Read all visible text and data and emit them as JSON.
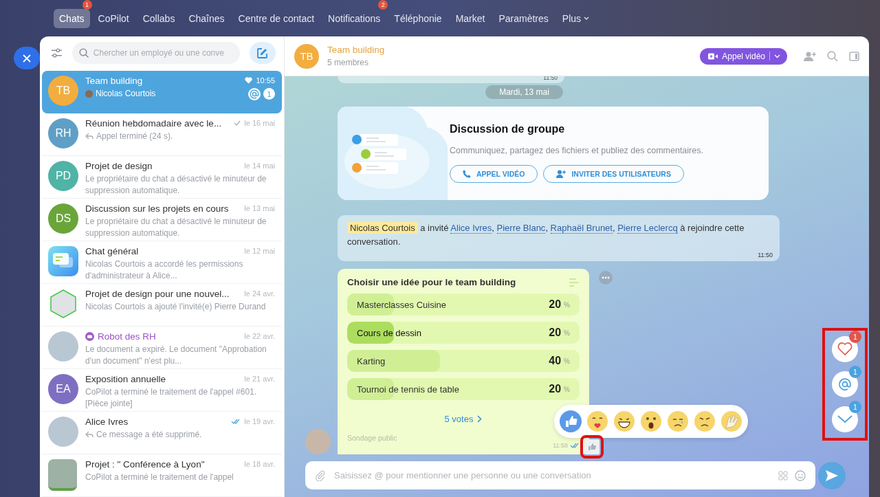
{
  "nav": [
    {
      "label": "Chats",
      "selected": true,
      "badge": "1"
    },
    {
      "label": "CoPilot",
      "selected": false
    },
    {
      "label": "Collabs",
      "selected": false
    },
    {
      "label": "Chaînes",
      "selected": false
    },
    {
      "label": "Centre de contact",
      "selected": false
    },
    {
      "label": "Notifications",
      "selected": false,
      "badge": "2"
    },
    {
      "label": "Téléphonie",
      "selected": false
    },
    {
      "label": "Market",
      "selected": false
    },
    {
      "label": "Paramètres",
      "selected": false
    },
    {
      "label": "Plus",
      "selected": false,
      "dropdown": true
    }
  ],
  "sidebar": {
    "search": {
      "placeholder": "Chercher un employé ou une conve"
    },
    "chats": [
      {
        "avatar": {
          "kind": "initials",
          "initials": "TB",
          "color": "#f2ad3e"
        },
        "name": "Team building",
        "bot": false,
        "time": "10:55",
        "favorite": true,
        "preview_prefix": {
          "kind": "author-avatar"
        },
        "preview": "Nicolas Courtois",
        "mention": true,
        "unread": "1",
        "selected": true
      },
      {
        "avatar": {
          "kind": "initials",
          "initials": "RH",
          "color": "#5f9fc6"
        },
        "name": "Réunion hebdomadaire avec le...",
        "bot": false,
        "time": "le 16 mai",
        "favorite": false,
        "check": {
          "kind": "sent"
        },
        "preview_prefix": {
          "kind": "reply"
        },
        "preview": "Appel terminé (24 s).",
        "mention": false,
        "selected": false
      },
      {
        "avatar": {
          "kind": "initials",
          "initials": "PD",
          "color": "#4fb3a6"
        },
        "name": "Projet de design",
        "bot": false,
        "time": "le 14 mai",
        "favorite": false,
        "preview": "Le propriétaire du chat a désactivé le minuteur de suppression automatique.",
        "mention": false,
        "selected": false
      },
      {
        "avatar": {
          "kind": "initials",
          "initials": "DS",
          "color": "#6aa53a"
        },
        "name": "Discussion sur les projets en cours",
        "bot": false,
        "time": "le 13 mai",
        "favorite": false,
        "preview": "Le propriétaire du chat a désactivé le minuteur de suppression automatique.",
        "mention": false,
        "selected": false
      },
      {
        "avatar": {
          "kind": "app"
        },
        "name": "Chat général",
        "bot": false,
        "time": "le 12 mai",
        "favorite": false,
        "preview": "Nicolas Courtois a accordé les permissions d'administrateur à Alice...",
        "mention": false,
        "selected": false
      },
      {
        "avatar": {
          "kind": "hexagon-photo"
        },
        "name": "Projet de design pour une nouvel...",
        "bot": false,
        "time": "le 24 avr.",
        "favorite": false,
        "preview": "Nicolas Courtois a ajouté l'invité(e) Pierre Durand",
        "mention": false,
        "selected": false
      },
      {
        "avatar": {
          "kind": "photo"
        },
        "name": "Robot des RH",
        "bot": true,
        "time": "le 22 avr.",
        "favorite": false,
        "preview": "Le document a expiré. Le document \"Approbation d'un document\" n'est plu...",
        "mention": false,
        "selected": false
      },
      {
        "avatar": {
          "kind": "initials",
          "initials": "EA",
          "color": "#7f6fc2"
        },
        "name": "Exposition annuelle",
        "bot": false,
        "time": "le 21 avr.",
        "favorite": false,
        "preview": "CoPilot a terminé le traitement de l'appel #601. [Pièce jointe]",
        "mention": false,
        "selected": false
      },
      {
        "avatar": {
          "kind": "photo"
        },
        "name": "Alice Ivres",
        "bot": false,
        "time": "le 19 avr.",
        "favorite": false,
        "check": {
          "kind": "read"
        },
        "preview_prefix": {
          "kind": "reply"
        },
        "preview": "Ce message a été supprimé.",
        "mention": false,
        "selected": false
      },
      {
        "avatar": {
          "kind": "square-photo"
        },
        "name": "Projet : \" Conférence à Lyon\"",
        "bot": false,
        "time": "le 18 avr.",
        "favorite": false,
        "preview": "CoPilot a terminé le traitement de l'appel",
        "mention": false,
        "selected": false
      }
    ]
  },
  "header": {
    "initials": "TB",
    "title": "Team building",
    "subtitle": "5 membres",
    "call_button": "Appel vidéo"
  },
  "messages": {
    "previous_time": "11:50",
    "date": "Mardi, 13 mai",
    "group_card": {
      "title": "Discussion de groupe",
      "text": "Communiquez, partagez des fichiers et publiez des commentaires.",
      "buttons": [
        {
          "kind": "call",
          "label": "APPEL VIDÉO"
        },
        {
          "kind": "invite",
          "label": "INVITER DES UTILISATEURS"
        }
      ]
    },
    "system": {
      "parts": [
        {
          "kind": "mention",
          "text": "Nicolas Courtois"
        },
        {
          "kind": "plain",
          "text": " a invité "
        },
        {
          "kind": "link",
          "text": "Alice Ivres"
        },
        {
          "kind": "plain",
          "text": ", "
        },
        {
          "kind": "link",
          "text": "Pierre Blanc"
        },
        {
          "kind": "plain",
          "text": ", "
        },
        {
          "kind": "link",
          "text": "Raphaël Brunet"
        },
        {
          "kind": "plain",
          "text": ", "
        },
        {
          "kind": "link",
          "text": "Pierre Leclercq"
        },
        {
          "kind": "plain",
          "text": " à rejoindre cette conversation."
        }
      ],
      "time": "11:50"
    },
    "poll": {
      "title": "Choisir une idée pour le team building",
      "options": [
        {
          "label": "Masterclasses Cuisine",
          "percent": "20",
          "unit": "%",
          "level": 0.2,
          "selected": false
        },
        {
          "label": "Cours de dessin",
          "percent": "20",
          "unit": "%",
          "level": 0.2,
          "selected": true
        },
        {
          "label": "Karting",
          "percent": "40",
          "unit": "%",
          "level": 0.4,
          "selected": false
        },
        {
          "label": "Tournoi de tennis de table",
          "percent": "20",
          "unit": "%",
          "level": 0.2,
          "selected": false
        }
      ],
      "votes": "5 votes",
      "footer": "Sondage public",
      "time": "11:58",
      "read": true
    },
    "reactions": [
      {
        "kind": "like"
      },
      {
        "kind": "love"
      },
      {
        "kind": "laugh"
      },
      {
        "kind": "wow"
      },
      {
        "kind": "sad"
      },
      {
        "kind": "angry"
      },
      {
        "kind": "facepalm"
      }
    ],
    "reaction_chip": {
      "highlighted": true
    }
  },
  "composer": {
    "placeholder": "Saisissez @ pour mentionner une personne ou une conversation"
  },
  "floating": {
    "highlighted": true,
    "buttons": [
      {
        "kind": "reactions",
        "badge": "1",
        "color": "#e0564c"
      },
      {
        "kind": "mentions",
        "badge": "1",
        "color": "#4aa3df"
      },
      {
        "kind": "scroll-down",
        "badge": "1",
        "color": "#4aa3df"
      }
    ]
  }
}
